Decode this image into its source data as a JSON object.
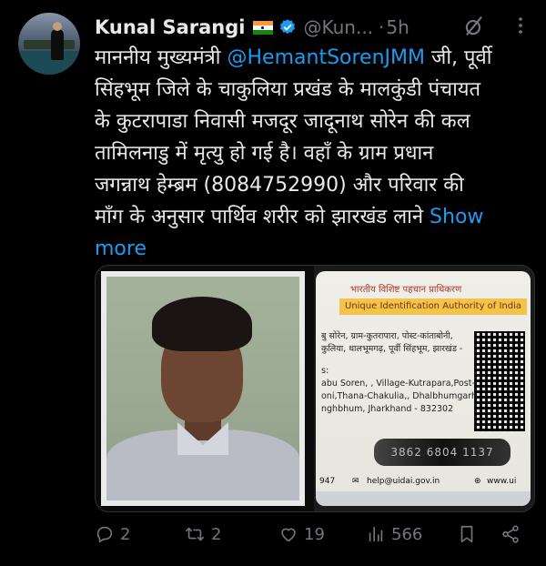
{
  "tweet": {
    "author_name": "Kunal Sarangi",
    "handle": "@Kun...",
    "separator": "·",
    "time": "5h",
    "text_lines": [
      [
        "माननीय मुख्यमंत्री ",
        "@HemantSorenJMM",
        " जी, पूर्वी"
      ],
      "सिंहभूम जिले के चाकुलिया प्रखंड के मालकुंडी पंचायत",
      "के कुटरापाडा निवासी मजदूर जादूनाथ सोरेन की कल",
      "तामिलनाडु में मृत्यु हो गई है। वहाँ के ग्राम प्रधान",
      "जगन्नाथ हेम्ब्रम (8084752990) और परिवार की",
      "माँग के अनुसार पार्थिव शरीर को झारखंड लाने "
    ],
    "show_more": "Show more"
  },
  "media": {
    "id_card": {
      "hindi_header": "भारतीय विशिष्ट पहचान प्राधिकरण",
      "authority": "Unique Identification Authority of India",
      "address_lines": [
        "बु सोरेन, ग्राम-कुतरापारा, पोस्ट-कांताबोनी,",
        "कुलिया, धालभूमगढ़, पूर्वी सिंहभूम, झारखंड -",
        "s:",
        "abu Soren, , Village-Kutrapara,Post-",
        "oni,Thana-Chakulia,, Dhalbhumgarh,",
        "nghbhum, Jharkhand - 832302"
      ],
      "number": "3862 6804 1137",
      "footer_left": "947",
      "footer_email": "help@uidai.gov.in",
      "footer_web": "www.ui"
    }
  },
  "actions": {
    "replies": "2",
    "reposts": "2",
    "likes": "19",
    "views": "566"
  },
  "colors": {
    "background": "#000000",
    "text": "#e7e9ea",
    "muted": "#71767b",
    "accent": "#1d9bf0"
  }
}
